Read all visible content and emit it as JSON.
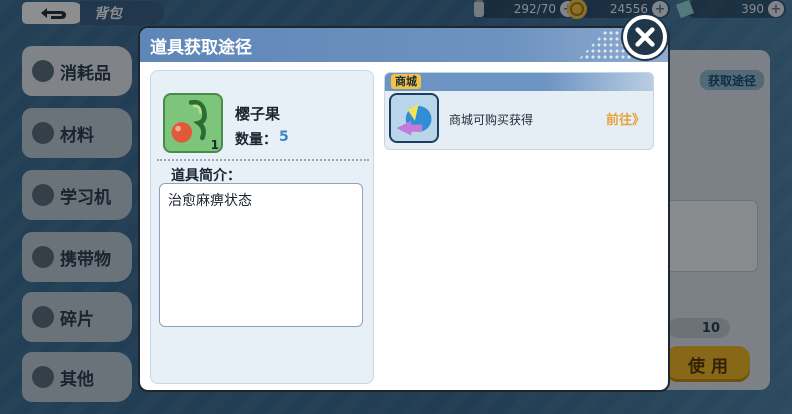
{
  "topbar": {
    "page_title": "背包",
    "currencies": [
      {
        "icon": "potion-icon",
        "value": "292/70"
      },
      {
        "icon": "coin-icon",
        "value": "24556"
      },
      {
        "icon": "gem-icon",
        "value": "390"
      }
    ],
    "plus_symbol": "+"
  },
  "sidebar": {
    "items": [
      {
        "label": "消耗品",
        "icon": "bottle-icon",
        "active": true
      },
      {
        "label": "材料",
        "icon": "material-icon",
        "active": false
      },
      {
        "label": "学习机",
        "icon": "disc-icon",
        "active": false
      },
      {
        "label": "携带物",
        "icon": "held-item-icon",
        "active": false
      },
      {
        "label": "碎片",
        "icon": "puzzle-icon",
        "active": false
      },
      {
        "label": "其他",
        "icon": "bike-icon",
        "active": false
      }
    ]
  },
  "background_panel": {
    "get_route_label": "获取途径",
    "quantity": "10",
    "use_label": "使 用"
  },
  "modal": {
    "title": "道具获取途径",
    "item": {
      "name": "樱子果",
      "quantity_label": "数量：",
      "quantity_value": "5",
      "badge": "1",
      "intro_label": "道具简介：",
      "intro_text": "治愈麻痹状态"
    },
    "sources": [
      {
        "tag": "商城",
        "text": "商城可购买获得",
        "action": "前往》"
      }
    ]
  },
  "colors": {
    "header_blue": "#6a8fbe",
    "accent_orange": "#e8a23a",
    "qty_blue": "#3c86c6",
    "use_button": "#e9b12a"
  }
}
